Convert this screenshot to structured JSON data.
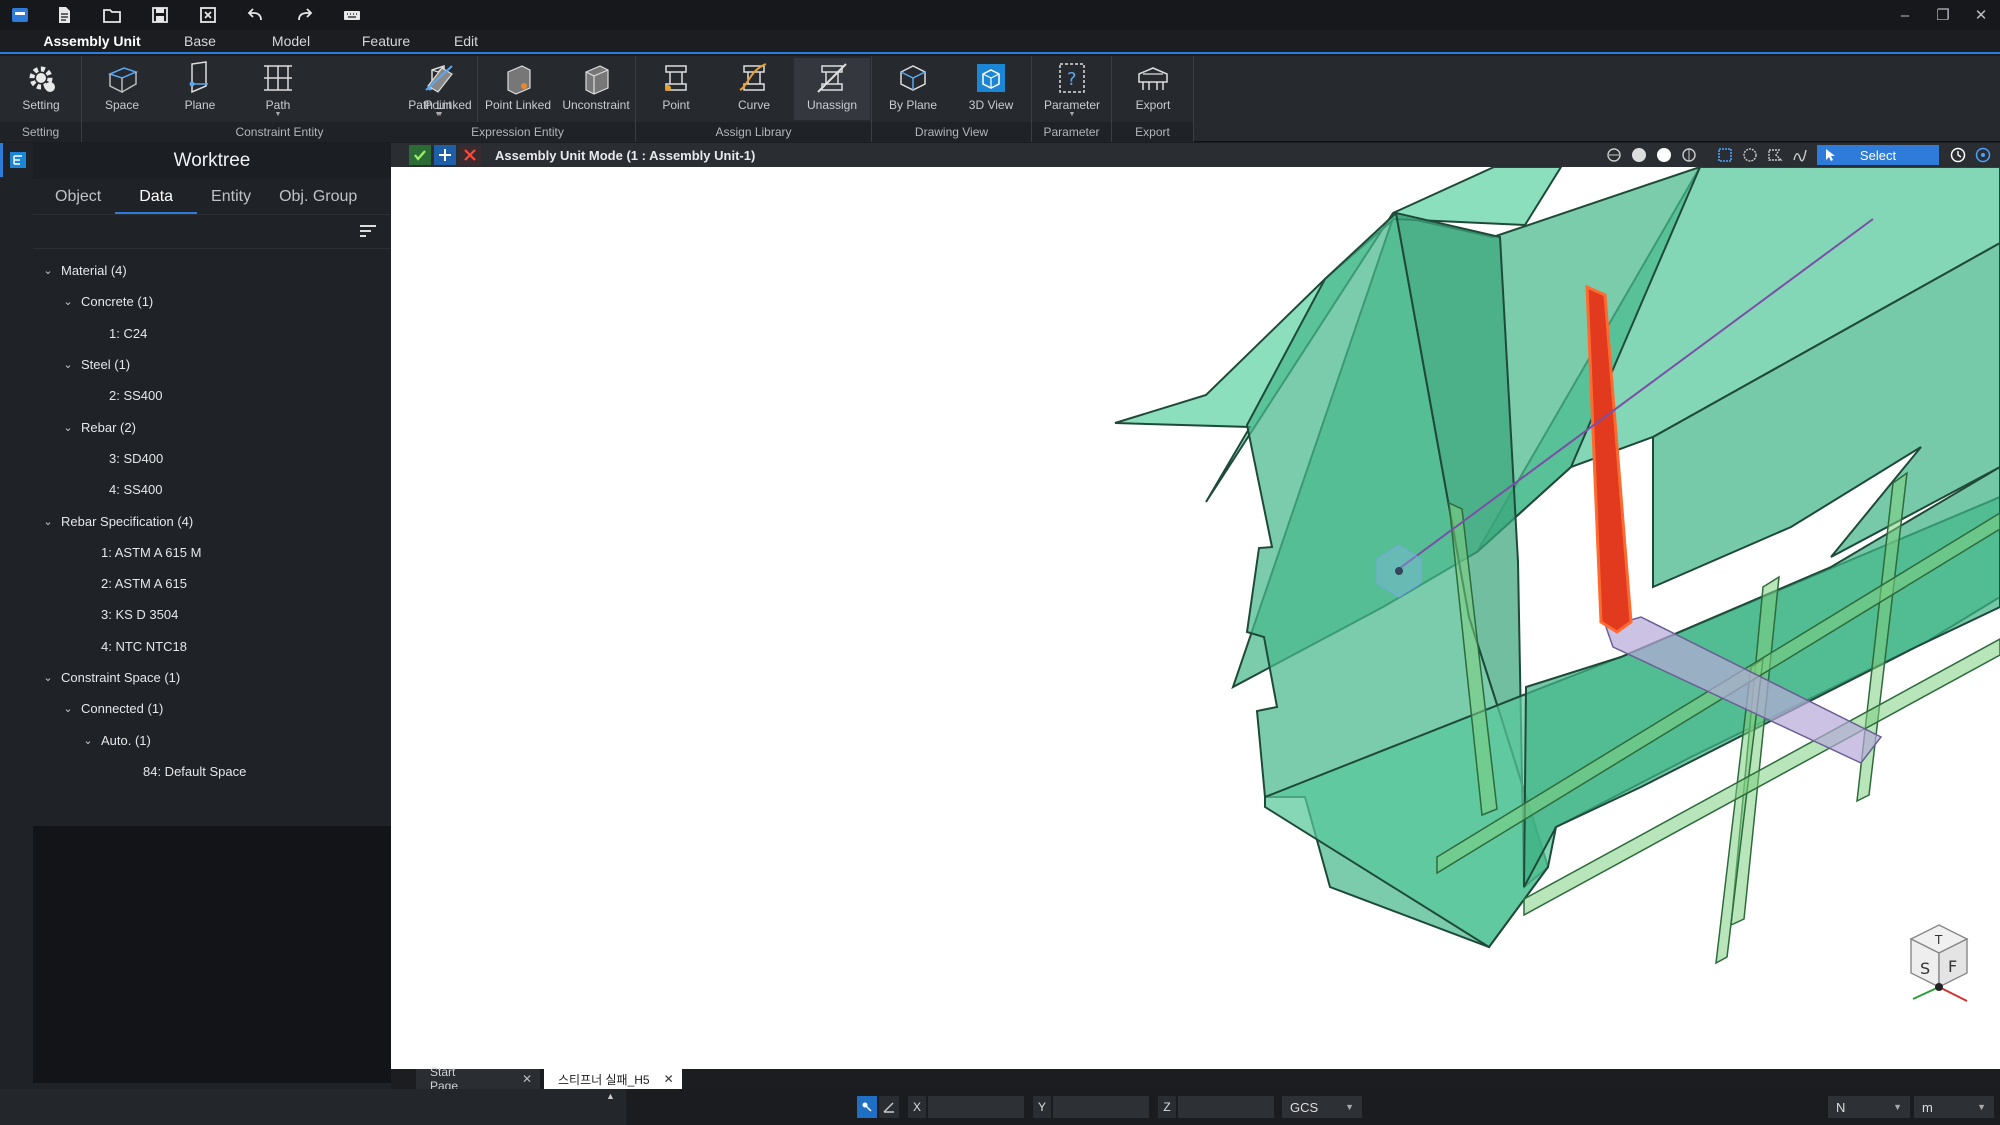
{
  "window": {
    "minimize_glyph": "–",
    "restore_glyph": "❐",
    "close_glyph": "✕"
  },
  "menu": {
    "tabs": [
      "Assembly Unit",
      "Base",
      "Model",
      "Feature",
      "Edit"
    ],
    "active": "Assembly Unit"
  },
  "ribbon": {
    "groups": [
      {
        "label": "Setting",
        "buttons": [
          {
            "label": "Setting",
            "icon": "gear-icon"
          }
        ]
      },
      {
        "label": "Constraint Entity",
        "buttons": [
          {
            "label": "Space",
            "icon": "space-icon"
          },
          {
            "label": "Plane",
            "icon": "plane-icon"
          },
          {
            "label": "Path",
            "icon": "path-icon"
          },
          {
            "label": "Point",
            "icon": "point-icon"
          }
        ]
      },
      {
        "label": "Expression Entity",
        "buttons": [
          {
            "label": "Path Linked",
            "icon": "path-linked-icon"
          },
          {
            "label": "Point Linked",
            "icon": "point-linked-icon"
          },
          {
            "label": "Unconstraint",
            "icon": "unconstraint-icon"
          }
        ]
      },
      {
        "label": "Assign Library",
        "buttons": [
          {
            "label": "Point",
            "icon": "assign-point-icon"
          },
          {
            "label": "Curve",
            "icon": "assign-curve-icon"
          },
          {
            "label": "Unassign",
            "icon": "unassign-icon"
          }
        ]
      },
      {
        "label": "Drawing View",
        "buttons": [
          {
            "label": "By Plane",
            "icon": "by-plane-icon"
          },
          {
            "label": "3D View",
            "icon": "3d-view-icon"
          }
        ]
      },
      {
        "label": "Parameter",
        "buttons": [
          {
            "label": "Parameter",
            "icon": "parameter-icon"
          }
        ]
      },
      {
        "label": "Export",
        "buttons": [
          {
            "label": "Export",
            "icon": "export-icon"
          }
        ]
      }
    ]
  },
  "worktree": {
    "title": "Worktree",
    "tabs": [
      "Object",
      "Data",
      "Entity",
      "Obj. Group"
    ],
    "active_tab": "Data",
    "nodes": [
      {
        "label": "Material (4)",
        "level": 0,
        "expanded": true
      },
      {
        "label": "Concrete (1)",
        "level": 1,
        "expanded": true
      },
      {
        "label": "1: C24",
        "level": 3
      },
      {
        "label": "Steel (1)",
        "level": 1,
        "expanded": true
      },
      {
        "label": "2: SS400",
        "level": 3
      },
      {
        "label": "Rebar (2)",
        "level": 1,
        "expanded": true
      },
      {
        "label": "3: SD400",
        "level": 3
      },
      {
        "label": "4: SS400",
        "level": 3
      },
      {
        "label": "Rebar Specification (4)",
        "level": 0,
        "expanded": true
      },
      {
        "label": "1: ASTM A 615 M",
        "level": 2
      },
      {
        "label": "2: ASTM A 615",
        "level": 2
      },
      {
        "label": "3: KS D 3504",
        "level": 2
      },
      {
        "label": "4: NTC NTC18",
        "level": 2
      },
      {
        "label": "Constraint Space (1)",
        "level": 0,
        "expanded": true
      },
      {
        "label": "Connected (1)",
        "level": 1,
        "expanded": true
      },
      {
        "label": "Auto. (1)",
        "level": 2,
        "expanded": true
      },
      {
        "label": "84: Default Space",
        "level": 4
      }
    ]
  },
  "viewport": {
    "mode_text": "Assembly Unit Mode (1 : Assembly Unit-1)",
    "select_label": "Select",
    "view_cube": {
      "top": "T",
      "left": "S",
      "right": "F"
    },
    "colors": {
      "concrete": "#3fbf8c",
      "edge": "#1f4a3a",
      "highlight": "#e23a1e",
      "axis": "#7a4fa6"
    }
  },
  "doc_tabs": [
    {
      "label": "Start Page",
      "active": false
    },
    {
      "label": "스티프너 실패_H5",
      "active": true
    }
  ],
  "status": {
    "x_label": "X",
    "y_label": "Y",
    "z_label": "Z",
    "x_value": "",
    "y_value": "",
    "z_value": "",
    "coord_system": "GCS",
    "force_unit": "N",
    "length_unit": "m"
  }
}
